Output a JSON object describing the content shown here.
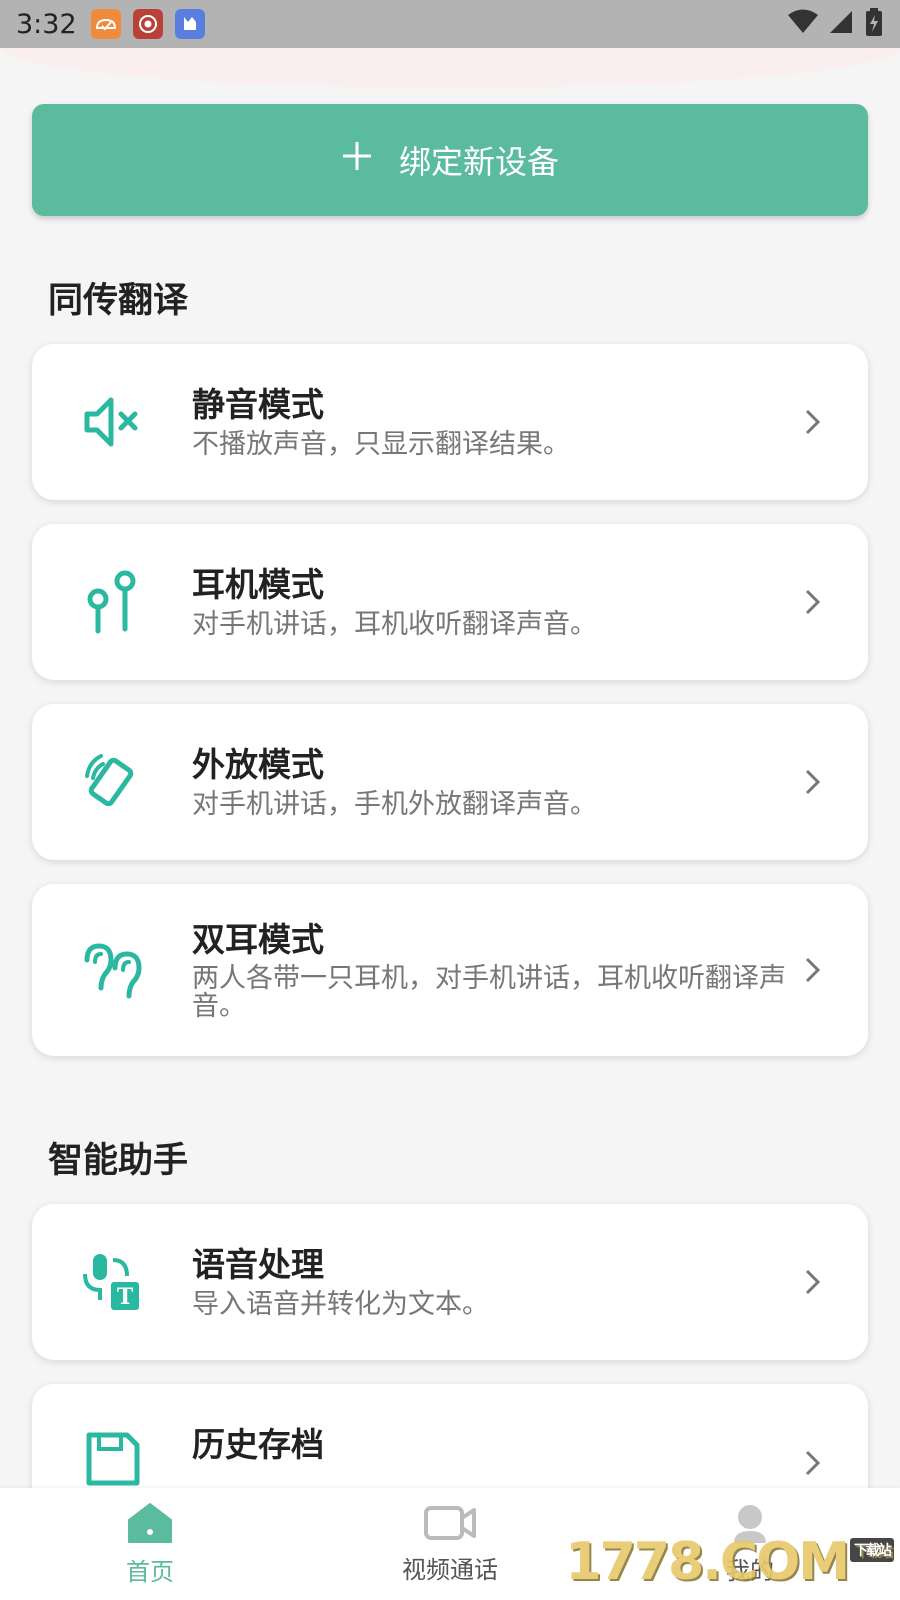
{
  "status_bar": {
    "time": "3:32",
    "notifications": [
      "notif-app-1",
      "notif-app-2",
      "notif-app-3"
    ],
    "icons": [
      "wifi-icon",
      "signal-icon",
      "battery-charging-icon"
    ]
  },
  "bind_button": {
    "icon": "plus-icon",
    "label": "绑定新设备"
  },
  "sections": [
    {
      "title": "同传翻译",
      "items": [
        {
          "icon": "speaker-mute-icon",
          "title": "静音模式",
          "desc": "不播放声音，只显示翻译结果。"
        },
        {
          "icon": "earphones-icon",
          "title": "耳机模式",
          "desc": "对手机讲话，耳机收听翻译声音。"
        },
        {
          "icon": "phone-vibrate-icon",
          "title": "外放模式",
          "desc": "对手机讲话，手机外放翻译声音。"
        },
        {
          "icon": "ears-icon",
          "title": "双耳模式",
          "desc": "两人各带一只耳机，对手机讲话，耳机收听翻译声音。"
        }
      ]
    },
    {
      "title": "智能助手",
      "items": [
        {
          "icon": "mic-to-text-icon",
          "title": "语音处理",
          "desc": "导入语音并转化为文本。"
        },
        {
          "icon": "save-icon",
          "title": "历史存档",
          "desc": ""
        }
      ]
    }
  ],
  "bottom_nav": [
    {
      "icon": "home-icon",
      "label": "首页",
      "active": true
    },
    {
      "icon": "video-call-icon",
      "label": "视频通话",
      "active": false
    },
    {
      "icon": "user-icon",
      "label": "我的",
      "active": false
    }
  ],
  "watermark": {
    "text": "1778.COM",
    "badge": "下载站"
  },
  "colors": {
    "accent": "#5bbb9e",
    "background": "#f5f5f5",
    "status_bar": "#b3b3b3"
  }
}
